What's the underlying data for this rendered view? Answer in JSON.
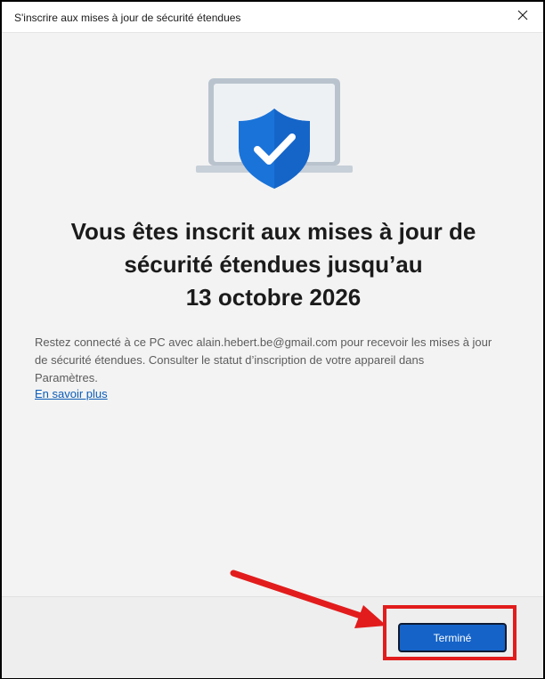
{
  "window": {
    "title": "S'inscrire aux mises à jour de sécurité étendues"
  },
  "main": {
    "heading_lines": [
      "Vous êtes inscrit aux mises à jour de",
      "sécurité étendues jusqu’au",
      "13 octobre 2026"
    ],
    "body_lines": [
      "Restez connecté à ce PC avec alain.hebert.be@gmail.com pour recevoir les mises à jour",
      "de sécurité étendues. Consulter le statut d’inscription de votre appareil dans",
      "Paramètres."
    ],
    "learn_more_link": "En savoir plus"
  },
  "footer": {
    "done_label": "Terminé"
  },
  "icons": {
    "close": "close-icon",
    "hero": "laptop-shield-check-icon",
    "annotation": "red-arrow"
  },
  "colors": {
    "accent": "#1563c8",
    "shield": "#1a73d9",
    "annotation_red": "#e21c1c",
    "link": "#0b5cb8"
  }
}
